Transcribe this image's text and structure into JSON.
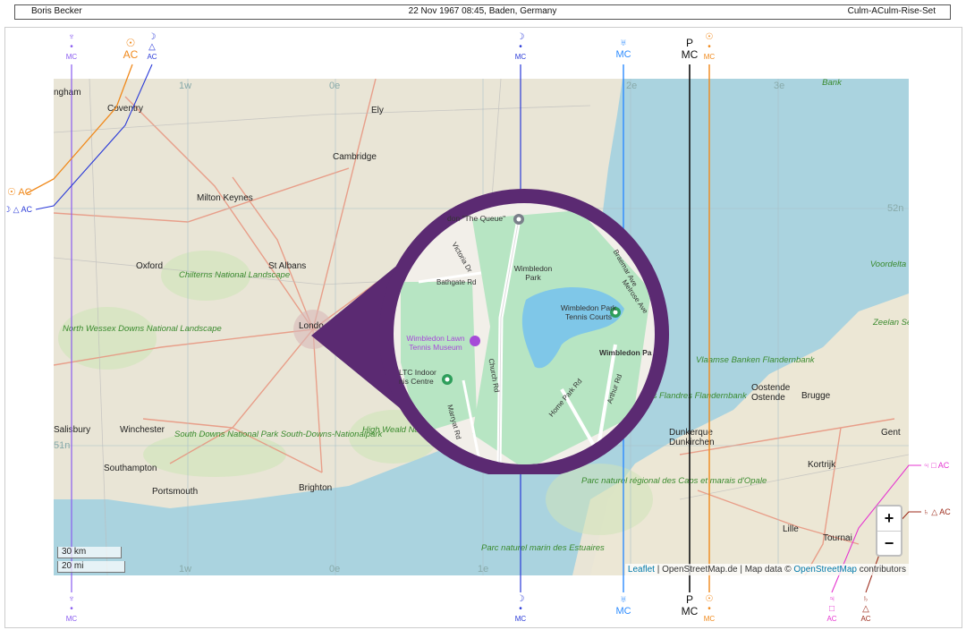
{
  "header": {
    "name": "Boris Becker",
    "birth": "22 Nov 1967 08:45, Baden, Germany",
    "mode": "Culm-ACulm-Rise-Set"
  },
  "map": {
    "cities": [
      "ngham",
      "Coventry",
      "Ely",
      "Cambridge",
      "Milton Keynes",
      "Oxford",
      "St Albans",
      "Londo",
      "Salisbury",
      "Winchester",
      "Southampton",
      "Portsmouth",
      "Brighton",
      "Dunkerque",
      "Dunkirchen",
      "Oostende",
      "Ostende",
      "Brugge",
      "Gent",
      "Kortrijk",
      "Lille",
      "Tournai"
    ],
    "parks": [
      "Chilterns National Landscape",
      "North Wessex Downs National Landscape",
      "South Downs National Park South-Downs-Nationalpark",
      "High Weald National Landscape",
      "Vlaamse Banken Flandernbank",
      "Bancs des Flandres Flandernbank",
      "Parc naturel régional des Caps et marais d'Opale",
      "Parc naturel marin des Estuaires",
      "Voordelta",
      "Zeelan Seelan",
      "Bank"
    ],
    "grid": [
      "1w",
      "0e",
      "1e",
      "2e",
      "3e",
      "52n",
      "51n"
    ],
    "inset": {
      "labels": [
        "don \"The Queue\"",
        "Wimbledon Park",
        "Wimbledon Park Tennis Courts",
        "Wimbledon Lawn Tennis Museum",
        "Wimbledon Pa",
        "LTC Indoor nis Centre",
        "Church Rd",
        "Home Park Rd",
        "Arthur Rd",
        "Victoria Dr",
        "Bathgate Rd",
        "Marryat Rd",
        "Melrose Ave",
        "Braemar Ave"
      ]
    },
    "scale_km": "30 km",
    "scale_mi": "20 mi",
    "zoom_in": "+",
    "zoom_out": "−",
    "attribution": {
      "leaflet": "Leaflet",
      "text1": " | OpenStreetMap.de | Map data © ",
      "osm": "OpenStreetMap",
      "text2": " contributors"
    }
  },
  "astro_lines": {
    "colors": {
      "neptune": "#8a5cf0",
      "sun": "#f0891b",
      "moon": "#2a3ad8",
      "uranus": "#2d8cff",
      "pluto": "#111111",
      "jupiter": "#e535d0",
      "saturn": "#9c2a1a"
    },
    "top": [
      {
        "glyph": "♆",
        "sub": "•",
        "tag": "MC"
      },
      {
        "glyph": "☉",
        "sub": "",
        "tag": "AC"
      },
      {
        "glyph": "☽",
        "sub": "△",
        "tag": "AC"
      },
      {
        "glyph": "☽",
        "sub": "•",
        "tag": "MC"
      },
      {
        "glyph": "♅",
        "sub": "",
        "tag": "MC"
      },
      {
        "glyph": "P",
        "sub": "",
        "tag": "MC"
      },
      {
        "glyph": "☉",
        "sub": "•",
        "tag": "MC"
      }
    ],
    "left": [
      {
        "glyph": "☉",
        "tag": "AC"
      },
      {
        "glyph": "☽ △",
        "tag": "AC"
      }
    ],
    "right": [
      {
        "glyph": "♃ □",
        "tag": "AC"
      },
      {
        "glyph": "♄ △",
        "tag": "AC"
      }
    ],
    "bottom": [
      {
        "glyph": "♆",
        "sub": "•",
        "tag": "MC"
      },
      {
        "glyph": "☽",
        "sub": "•",
        "tag": "MC"
      },
      {
        "glyph": "♅",
        "sub": "",
        "tag": "MC"
      },
      {
        "glyph": "P",
        "sub": "",
        "tag": "MC"
      },
      {
        "glyph": "☉",
        "sub": "•",
        "tag": "MC"
      },
      {
        "glyph": "♃",
        "sub": "□",
        "tag": "AC"
      },
      {
        "glyph": "♄",
        "sub": "△",
        "tag": "AC"
      }
    ]
  }
}
